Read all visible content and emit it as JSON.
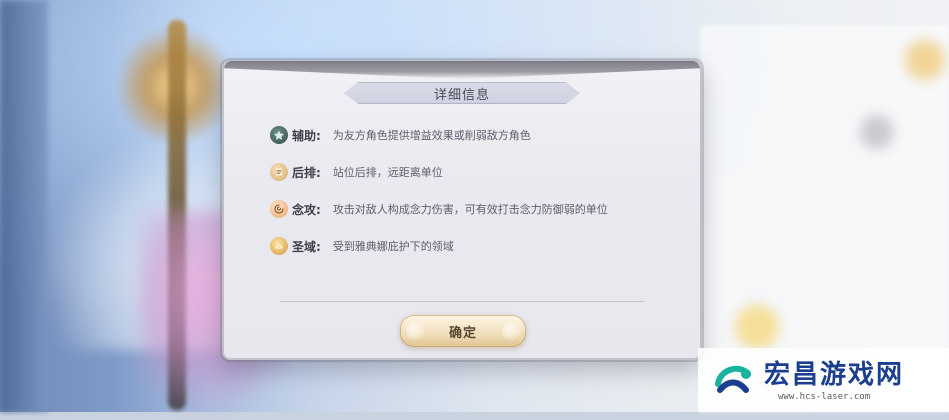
{
  "dialog": {
    "title": "详细信息",
    "items": [
      {
        "icon": "support-icon",
        "label": "辅助:",
        "desc": "为友方角色提供增益效果或削弱敌方角色"
      },
      {
        "icon": "back-row-icon",
        "label": "后排:",
        "desc": "站位后排，远距离单位"
      },
      {
        "icon": "mind-attack-icon",
        "label": "念攻:",
        "desc": "攻击对敌人构成念力伤害，可有效打击念力防御弱的单位"
      },
      {
        "icon": "domain-icon",
        "label": "圣域:",
        "desc": "受到雅典娜庇护下的领域"
      }
    ],
    "confirm_label": "确定",
    "colors": {
      "accent_gold": "#d9b26c",
      "dialog_bg": "#ececf2",
      "text_primary": "#3f3f4a",
      "text_secondary": "#5d5d6a"
    }
  },
  "watermark": {
    "title": "宏昌游戏网",
    "url": "www.hcs-laser.com",
    "colors": {
      "title": "#1c3e8e",
      "accent": "#19b3a0"
    }
  }
}
